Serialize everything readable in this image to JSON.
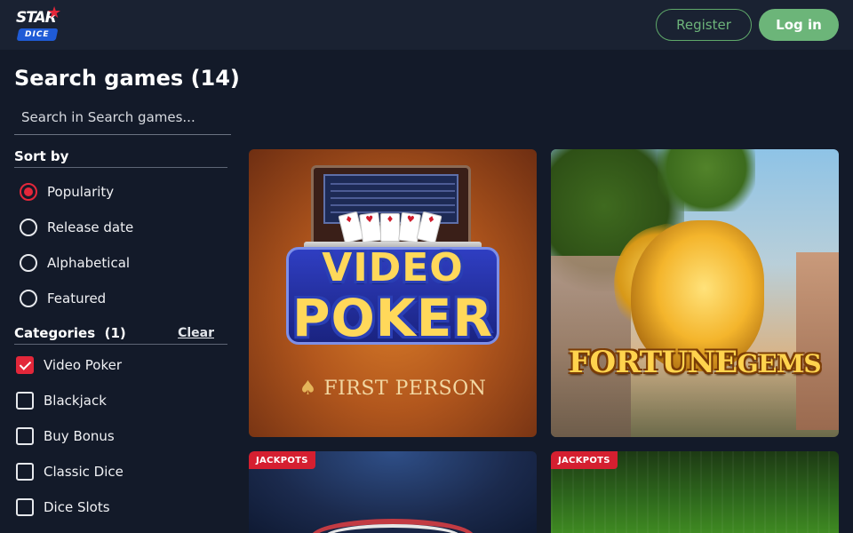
{
  "header": {
    "logo_top": "STAR",
    "logo_bottom": "DICE",
    "register_label": "Register",
    "login_label": "Log in"
  },
  "sidebar": {
    "title": "Search games (14)",
    "search_placeholder": "Search in Search games...",
    "sort_by_label": "Sort by",
    "sort_options": [
      {
        "label": "Popularity",
        "selected": true
      },
      {
        "label": "Release date",
        "selected": false
      },
      {
        "label": "Alphabetical",
        "selected": false
      },
      {
        "label": "Featured",
        "selected": false
      }
    ],
    "categories_label": "Categories  (1)",
    "clear_label": "Clear",
    "categories": [
      {
        "label": "Video Poker",
        "checked": true
      },
      {
        "label": "Blackjack",
        "checked": false
      },
      {
        "label": "Buy Bonus",
        "checked": false
      },
      {
        "label": "Classic Dice",
        "checked": false
      },
      {
        "label": "Dice Slots",
        "checked": false
      }
    ]
  },
  "games": [
    {
      "title_line1": "VIDEO",
      "title_line2": "POKER",
      "provider_line": "FIRST PERSON"
    },
    {
      "title": "FORTUNE",
      "title_cont": "GEMS"
    },
    {
      "badge": "JACKPOTS"
    },
    {
      "badge": "JACKPOTS"
    }
  ],
  "colors": {
    "background": "#131a29",
    "header": "#1a2232",
    "accent_red": "#e3273a",
    "login_green": "#6cb579",
    "register_border": "#5fa86a"
  }
}
